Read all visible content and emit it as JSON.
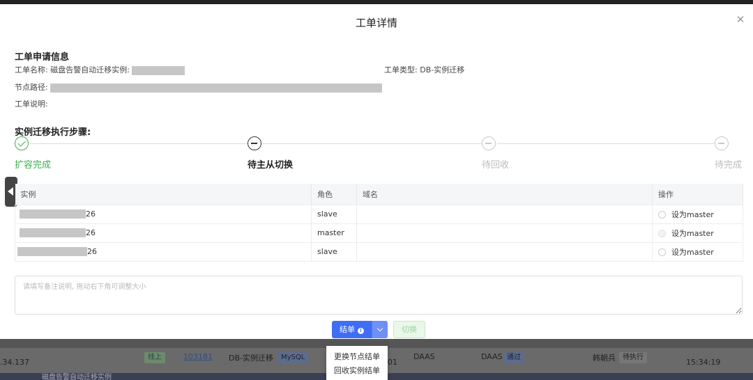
{
  "modal": {
    "title": "工单详情"
  },
  "apply_info": {
    "section_title": "工单申请信息",
    "name_label": "工单名称:",
    "name_value": "磁盘告警自动迁移实例:",
    "type_label": "工单类型:",
    "type_value": "DB-实例迁移",
    "path_label": "节点路径:",
    "desc_label": "工单说明:"
  },
  "steps": {
    "section_title": "实例迁移执行步骤:",
    "items": [
      {
        "label": "扩容完成",
        "status": "done"
      },
      {
        "label": "待主从切换",
        "status": "current"
      },
      {
        "label": "待回收",
        "status": "wait"
      },
      {
        "label": "待完成",
        "status": "wait"
      }
    ]
  },
  "table": {
    "headers": [
      "实例",
      "角色",
      "域名",
      "操作"
    ],
    "rows": [
      {
        "instance_suffix": "26",
        "role": "slave",
        "domain": "",
        "action": "设为master",
        "action_disabled": false
      },
      {
        "instance_suffix": "26",
        "role": "master",
        "domain": "",
        "action": "设为master",
        "action_disabled": true
      },
      {
        "instance_suffix": "26",
        "role": "slave",
        "domain": "",
        "action": "设为master",
        "action_disabled": false
      }
    ]
  },
  "remark": {
    "placeholder": "请填写备注说明, 拖动右下角可调整大小"
  },
  "buttons": {
    "close_label": "结单",
    "info_glyph": "!",
    "switch_label": "切换"
  },
  "dropdown": {
    "items": [
      "更换节点结单",
      "回收实例结单"
    ]
  },
  "background": {
    "ip_fragment": ".34.137",
    "tag_status": "线上",
    "link_id": "103181",
    "type": "DB-实例迁移",
    "db_tag": "MySQL",
    "num_fragment": "01",
    "owner1": "DAAS",
    "owner2": "DAAS",
    "tag_pass": "通过",
    "person": "韩朝兵",
    "state": "待执行",
    "time": "15:34:19",
    "bottom_fragment": "磁盘告警自动迁移实例"
  },
  "colors": {
    "primary": "#3f6ef5",
    "success": "#3bb14a"
  }
}
